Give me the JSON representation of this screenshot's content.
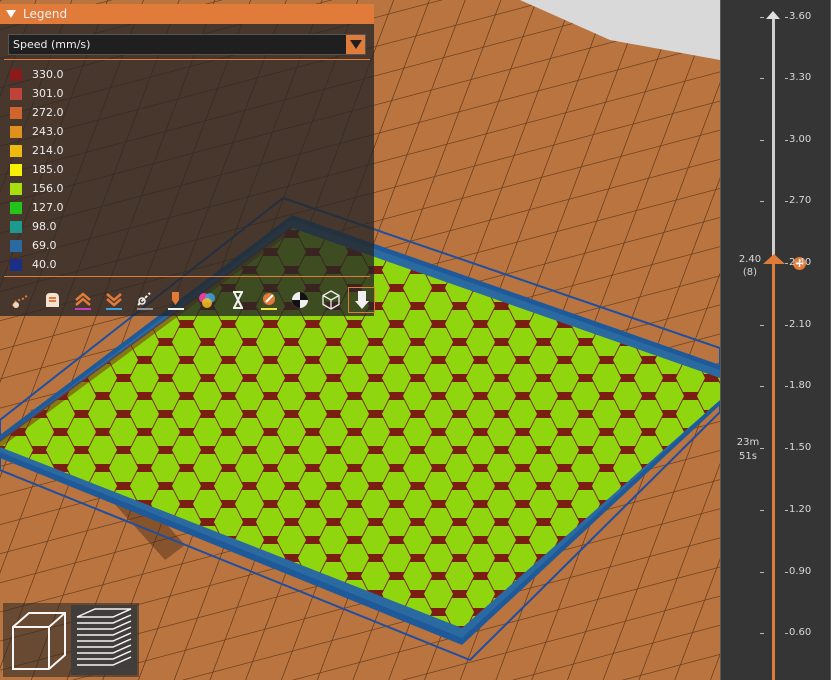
{
  "legend": {
    "title": "Legend",
    "view_type": "Speed (mm/s)",
    "items": [
      {
        "value": "330.0",
        "color": "#8b1a1a"
      },
      {
        "value": "301.0",
        "color": "#c0433a"
      },
      {
        "value": "272.0",
        "color": "#d2642e"
      },
      {
        "value": "243.0",
        "color": "#e0901c"
      },
      {
        "value": "214.0",
        "color": "#f0b90e"
      },
      {
        "value": "185.0",
        "color": "#f8ef04"
      },
      {
        "value": "156.0",
        "color": "#a6de10"
      },
      {
        "value": "127.0",
        "color": "#23c41a"
      },
      {
        "value": "98.0",
        "color": "#1d9a90"
      },
      {
        "value": "69.0",
        "color": "#2a6aa0"
      },
      {
        "value": "40.0",
        "color": "#1c2f88"
      }
    ],
    "toolbar_icons": [
      "travel-icon",
      "wipe-icon",
      "retractions-icon",
      "deretractions-icon",
      "seams-icon",
      "tool-changes-icon",
      "color-changes-icon",
      "pause-icon",
      "custom-gcode-icon",
      "center-of-gravity-icon",
      "shells-icon",
      "tool-marker-icon"
    ]
  },
  "slider": {
    "ticks": [
      "3.60",
      "3.30",
      "3.00",
      "2.70",
      "2.40",
      "2.10",
      "1.80",
      "1.50",
      "1.20",
      "0.90",
      "0.60"
    ],
    "current_height": "2.40",
    "current_layer": "(8)",
    "estimated_time_line1": "23m",
    "estimated_time_line2": "51s"
  },
  "colors": {
    "accent": "#e07b3a",
    "infill": "#8fd60e",
    "perimeter": "#8b1a1a",
    "brim": "#1e5a9a"
  },
  "view_toggle": {
    "icons": [
      "3d-view-icon",
      "layer-view-icon"
    ]
  }
}
